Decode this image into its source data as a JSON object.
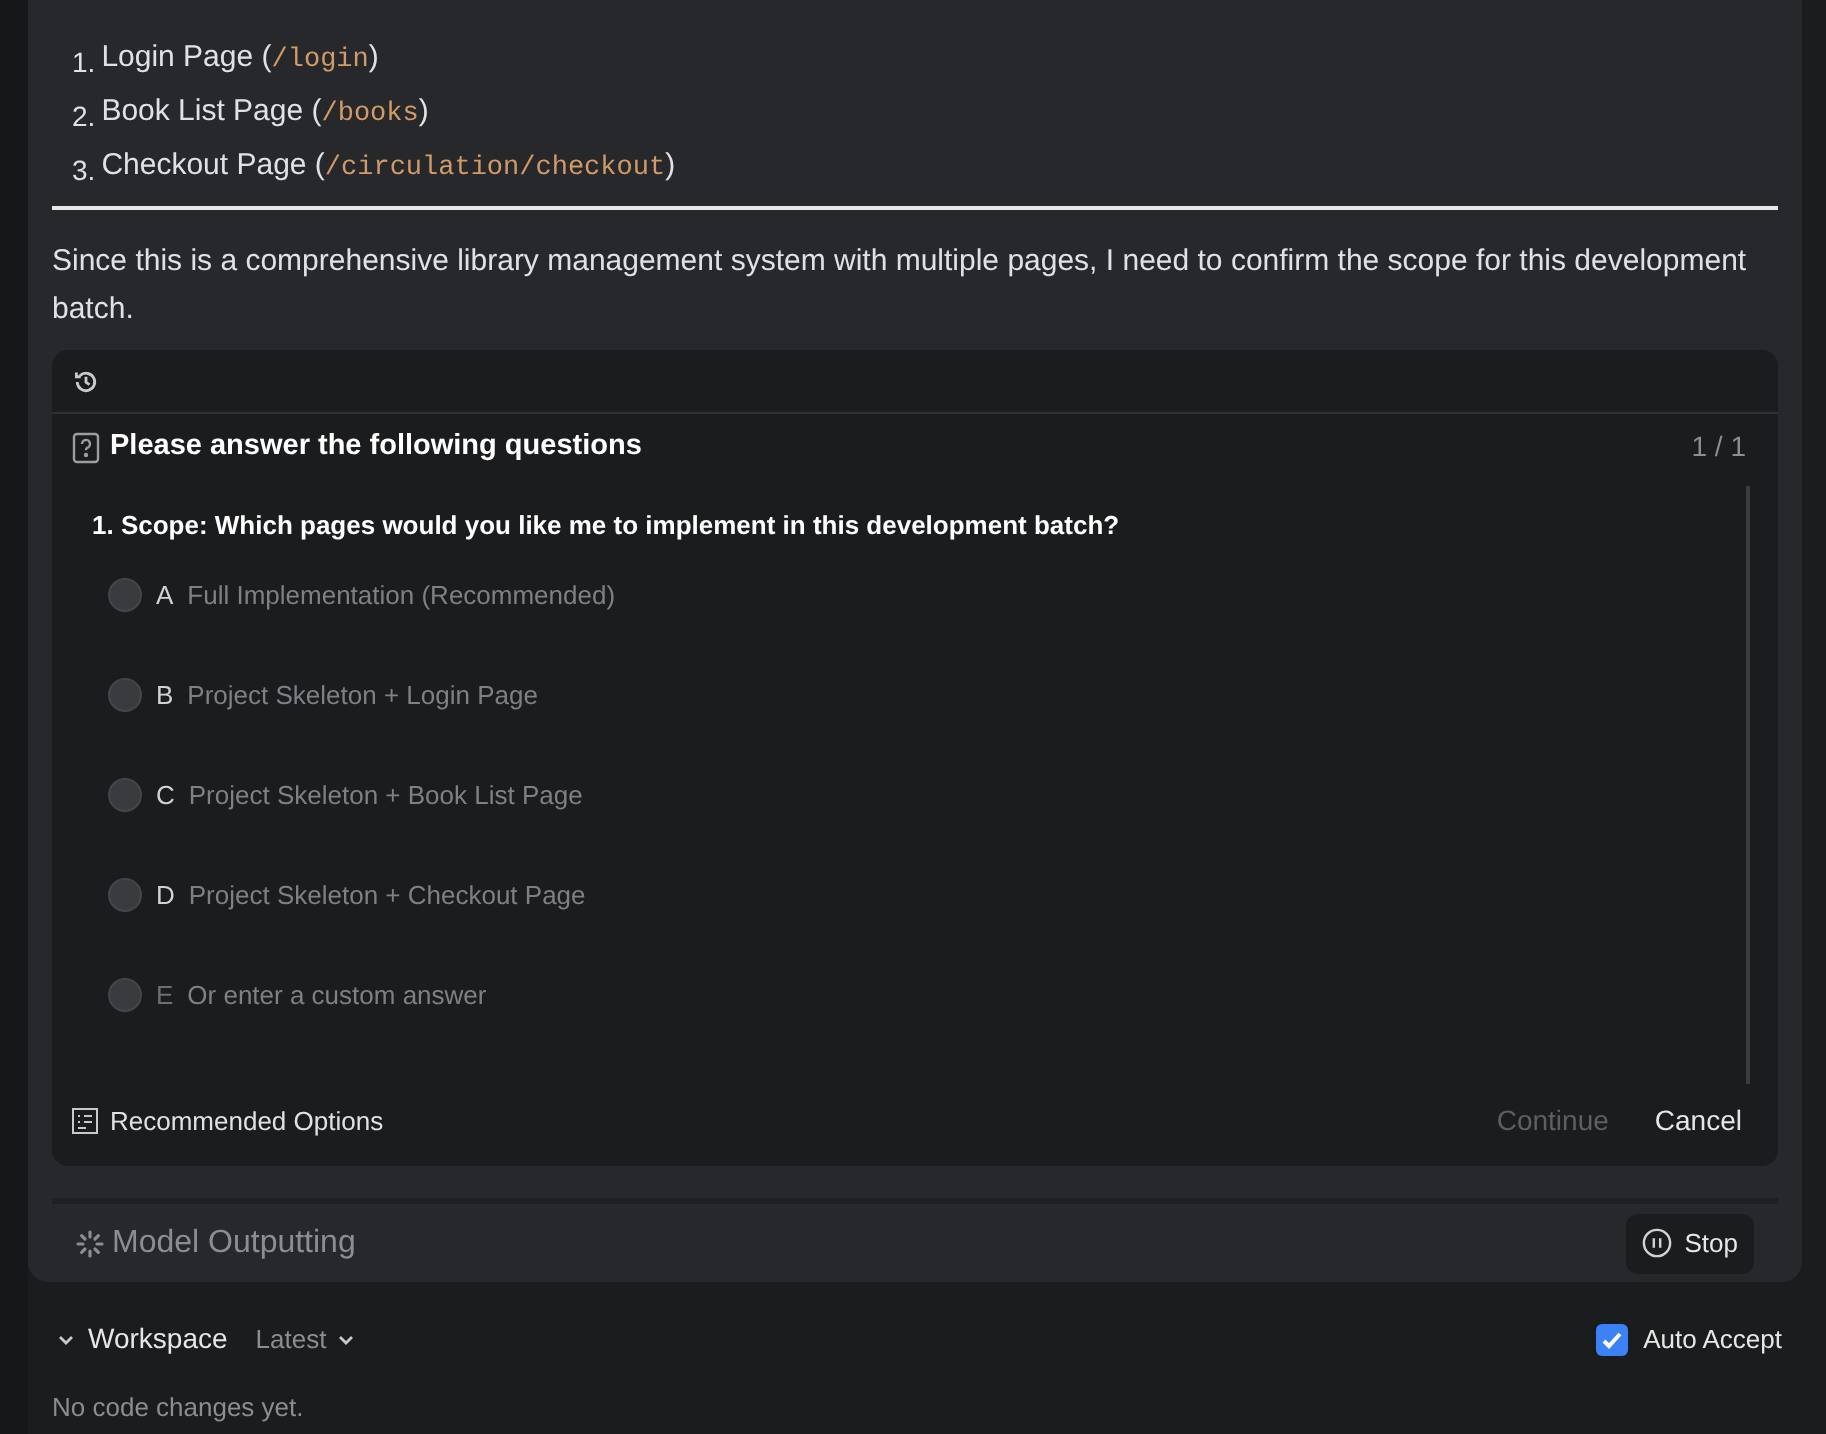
{
  "pages": [
    {
      "number": "1.",
      "parts": [
        {
          "text": "Login Page ("
        },
        {
          "text": "/login",
          "code": true
        },
        {
          "text": ")"
        }
      ]
    },
    {
      "number": "2.",
      "parts": [
        {
          "text": "Book List Page ("
        },
        {
          "text": "/books",
          "code": true
        },
        {
          "text": ")"
        }
      ]
    },
    {
      "number": "3.",
      "parts": [
        {
          "text": "Checkout Page ("
        },
        {
          "text": "/circulation/checkout",
          "code": true
        },
        {
          "text": ")"
        }
      ]
    }
  ],
  "message": "Since this is a comprehensive library management system with multiple pages, I need to confirm the scope for this development batch.",
  "question_card": {
    "title": "Please answer the following questions",
    "counter": "1 / 1",
    "question": "1. Scope: Which pages would you like me to implement in this development batch?",
    "options": [
      {
        "letter": "A",
        "label": "Full Implementation (Recommended)",
        "kind": "choice",
        "selected": false
      },
      {
        "letter": "B",
        "label": "Project Skeleton + Login Page",
        "kind": "choice",
        "selected": false
      },
      {
        "letter": "C",
        "label": "Project Skeleton + Book List Page",
        "kind": "choice",
        "selected": false
      },
      {
        "letter": "D",
        "label": "Project Skeleton + Checkout Page",
        "kind": "choice",
        "selected": false
      },
      {
        "letter": "E",
        "label": "Or enter a custom answer",
        "kind": "custom",
        "selected": false
      }
    ],
    "footer_label": "Recommended Options",
    "buttons": [
      {
        "label": "Continue",
        "disabled": true
      },
      {
        "label": "Cancel",
        "disabled": false
      }
    ]
  },
  "status": {
    "label": "Model Outputting",
    "stop_button": "Stop"
  },
  "workspace": {
    "title": "Workspace",
    "version": "Latest",
    "auto_accept": {
      "label": "Auto Accept",
      "checked": true
    },
    "empty_text": "No code changes yet."
  }
}
